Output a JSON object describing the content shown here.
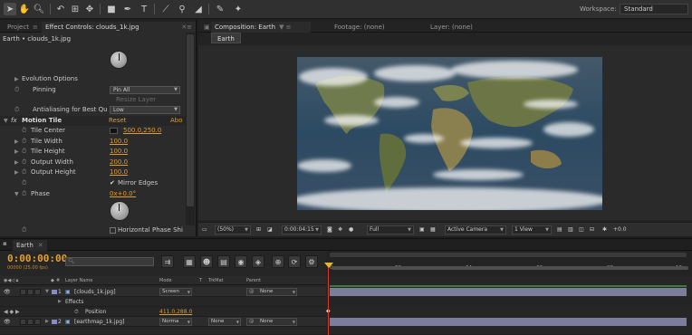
{
  "toolbar": {
    "icons": [
      "selection-tool-icon",
      "hand-tool-icon",
      "zoom-tool-icon",
      "rotate-tool-icon",
      "camera-orbit-icon",
      "pan-behind-icon",
      "mask-rect-icon",
      "pen-tool-icon",
      "text-tool-icon",
      "brush-tool-icon",
      "clone-stamp-icon",
      "eraser-icon",
      "roto-brush-icon",
      "puppet-pin-icon"
    ],
    "workspace_label": "Workspace:",
    "workspace_value": "Standard"
  },
  "left_panel": {
    "tab_project": "Project",
    "tab_effect_controls": "Effect Controls: clouds_1k.jpg",
    "subtitle": "Earth • clouds_1k.jpg",
    "rows": {
      "evolution_options": "Evolution Options",
      "pinning_label": "Pinning",
      "pinning_value": "Pin All",
      "resize_layer": "Resize Layer",
      "antialiasing_label": "Antialiasing for Best Qu",
      "antialiasing_value": "Low",
      "fx": "fx",
      "motion_tile": "Motion Tile",
      "reset": "Reset",
      "about": "Abo",
      "tile_center_label": "Tile Center",
      "tile_center_value": "500.0,250.0",
      "tile_width_label": "Tile Width",
      "tile_width_value": "100.0",
      "tile_height_label": "Tile Height",
      "tile_height_value": "100.0",
      "output_width_label": "Output Width",
      "output_width_value": "200.0",
      "output_height_label": "Output Height",
      "output_height_value": "100.0",
      "mirror_edges": "Mirror Edges",
      "phase_label": "Phase",
      "phase_value": "0x+0.0°",
      "horizontal_phase": "Horizontal Phase Shi"
    }
  },
  "comp_panel": {
    "tab_composition": "Composition: Earth",
    "tab_footage": "Footage: (none)",
    "tab_layer": "Layer: (none)",
    "comp_name": "Earth",
    "bottom": {
      "zoom": "(50%)",
      "timecode": "0:00:04:15",
      "resolution": "Full",
      "camera": "Active Camera",
      "view": "1 View",
      "exposure": "+0.0"
    }
  },
  "timeline": {
    "tab": "Earth",
    "timecode": "0:00:00:00",
    "fps": "00000 (25.00 fps)",
    "search_placeholder": "",
    "columns": {
      "layer_name": "Layer Name",
      "mode": "Mode",
      "t": "T",
      "trkmat": "TrkMat",
      "parent": "Parent"
    },
    "layers": [
      {
        "num": "1",
        "name": "[clouds_1k.jpg]",
        "mode": "Screen",
        "trkmat": "",
        "parent": "None"
      },
      {
        "num": "2",
        "name": "[earthmap_1k.jpg]",
        "mode": "Norma",
        "trkmat": "None",
        "parent": "None"
      }
    ],
    "effects_label": "Effects",
    "position_label": "Position",
    "position_value": "411.0,288.0",
    "ruler_ticks": [
      "0s",
      "02s",
      "04s",
      "06s",
      "08s",
      "10s"
    ],
    "accent_colors": {
      "layer_bar": "#7c7d9c",
      "cti": "#d43b2d",
      "orange": "#e19b2c"
    }
  }
}
